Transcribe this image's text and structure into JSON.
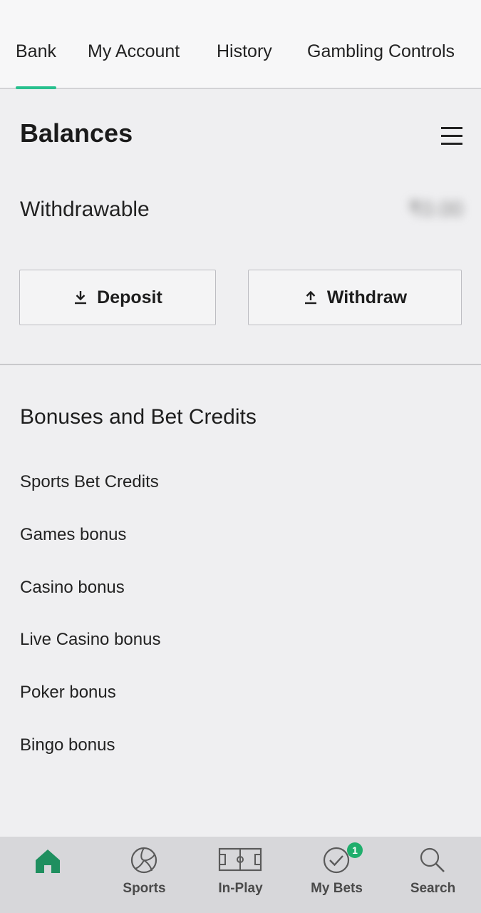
{
  "tabs": [
    {
      "label": "Bank",
      "active": true
    },
    {
      "label": "My Account"
    },
    {
      "label": "History"
    },
    {
      "label": "Gambling Controls"
    }
  ],
  "balances": {
    "title": "Balances",
    "withdrawable_label": "Withdrawable",
    "withdrawable_amount": "₹0.00"
  },
  "actions": {
    "deposit_label": "Deposit",
    "withdraw_label": "Withdraw"
  },
  "bonuses": {
    "title": "Bonuses and Bet Credits",
    "items": [
      "Sports Bet Credits",
      "Games bonus",
      "Casino bonus",
      "Live Casino bonus",
      "Poker bonus",
      "Bingo bonus"
    ]
  },
  "bottom_nav": {
    "items": [
      {
        "label": "",
        "icon": "home-icon",
        "active": true
      },
      {
        "label": "Sports",
        "icon": "sports-ball-icon"
      },
      {
        "label": "In-Play",
        "icon": "pitch-icon"
      },
      {
        "label": "My Bets",
        "icon": "check-circle-icon",
        "badge": "1"
      },
      {
        "label": "Search",
        "icon": "search-icon"
      }
    ]
  },
  "colors": {
    "accent": "#28c08e",
    "home_active": "#1f8f5f",
    "badge": "#1fae6c"
  }
}
